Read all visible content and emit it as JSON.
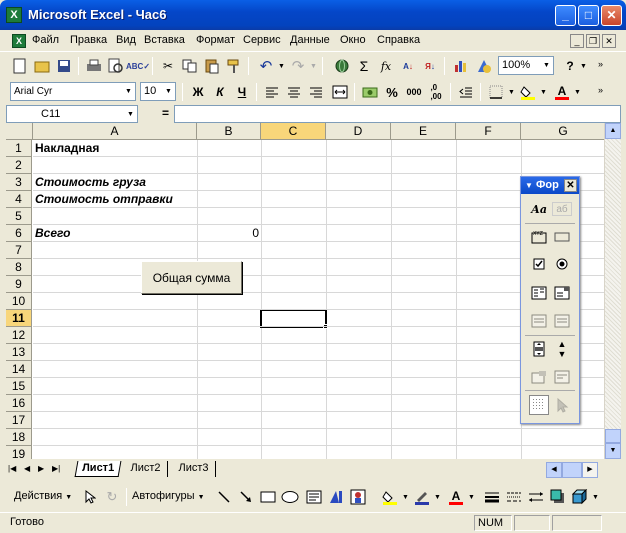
{
  "window": {
    "title": "Microsoft Excel - Час6"
  },
  "menu": [
    "Файл",
    "Правка",
    "Вид",
    "Вставка",
    "Формат",
    "Сервис",
    "Данные",
    "Окно",
    "Справка"
  ],
  "standard_toolbar": {
    "zoom": "100%"
  },
  "format_toolbar": {
    "font": "Arial Cyr",
    "size": "10",
    "bold": "Ж",
    "italic": "К",
    "underline": "Ч",
    "percent": "%",
    "thousands": "000"
  },
  "formula_bar": {
    "name_box": "C11",
    "equals": "="
  },
  "columns": [
    "A",
    "B",
    "C",
    "D",
    "E",
    "F",
    "G"
  ],
  "rows": [
    "1",
    "2",
    "3",
    "4",
    "5",
    "6",
    "7",
    "8",
    "9",
    "10",
    "11",
    "12",
    "13",
    "14",
    "15",
    "16",
    "17",
    "18",
    "19"
  ],
  "cells": {
    "A1": "Накладная",
    "A3": "Стоимость груза",
    "A4": "Стоимость отправки",
    "A6": "Всего",
    "B6": "0"
  },
  "sheet_button": {
    "label": "Общая сумма"
  },
  "forms_toolbar": {
    "title": "Фор",
    "label_btn": "Аа",
    "edit_btn": "аб"
  },
  "sheet_tabs": [
    "Лист1",
    "Лист2",
    "Лист3"
  ],
  "drawing_toolbar": {
    "actions": "Действия",
    "autoshapes": "Автофигуры"
  },
  "status": {
    "ready": "Готово",
    "num": "NUM"
  },
  "colors": {
    "title_bar": "#0A5FE6",
    "active_cell_border": "#000000"
  }
}
